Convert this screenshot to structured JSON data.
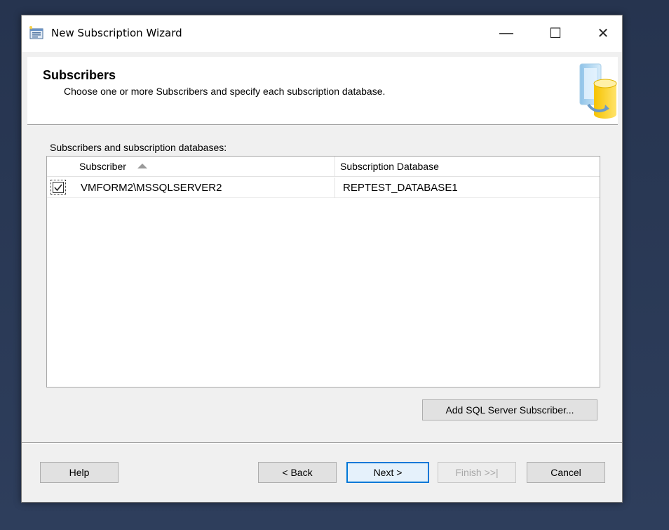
{
  "window": {
    "title": "New Subscription Wizard",
    "minimize_glyph": "—",
    "maximize_glyph": "☐",
    "close_glyph": "✕"
  },
  "banner": {
    "title": "Subscribers",
    "subtitle": "Choose one or more Subscribers and specify each subscription database."
  },
  "list": {
    "label": "Subscribers and subscription databases:",
    "columns": {
      "subscriber": "Subscriber",
      "database": "Subscription Database"
    },
    "rows": [
      {
        "checked": true,
        "subscriber": "VMFORM2\\MSSQLSERVER2",
        "database": "REPTEST_DATABASE1"
      }
    ]
  },
  "buttons": {
    "add_subscriber": "Add SQL Server Subscriber...",
    "help": "Help",
    "back": "< Back",
    "next": "Next >",
    "finish": "Finish >>|",
    "cancel": "Cancel"
  },
  "colors": {
    "accent": "#0078d7",
    "desktop": "#2b3a55",
    "dialog_bg": "#f0f0f0"
  },
  "icons": {
    "app": "wizard-app-icon",
    "banner": "database-sync-icon",
    "checkbox": "checkmark-icon",
    "sort": "sort-ascending-icon"
  }
}
